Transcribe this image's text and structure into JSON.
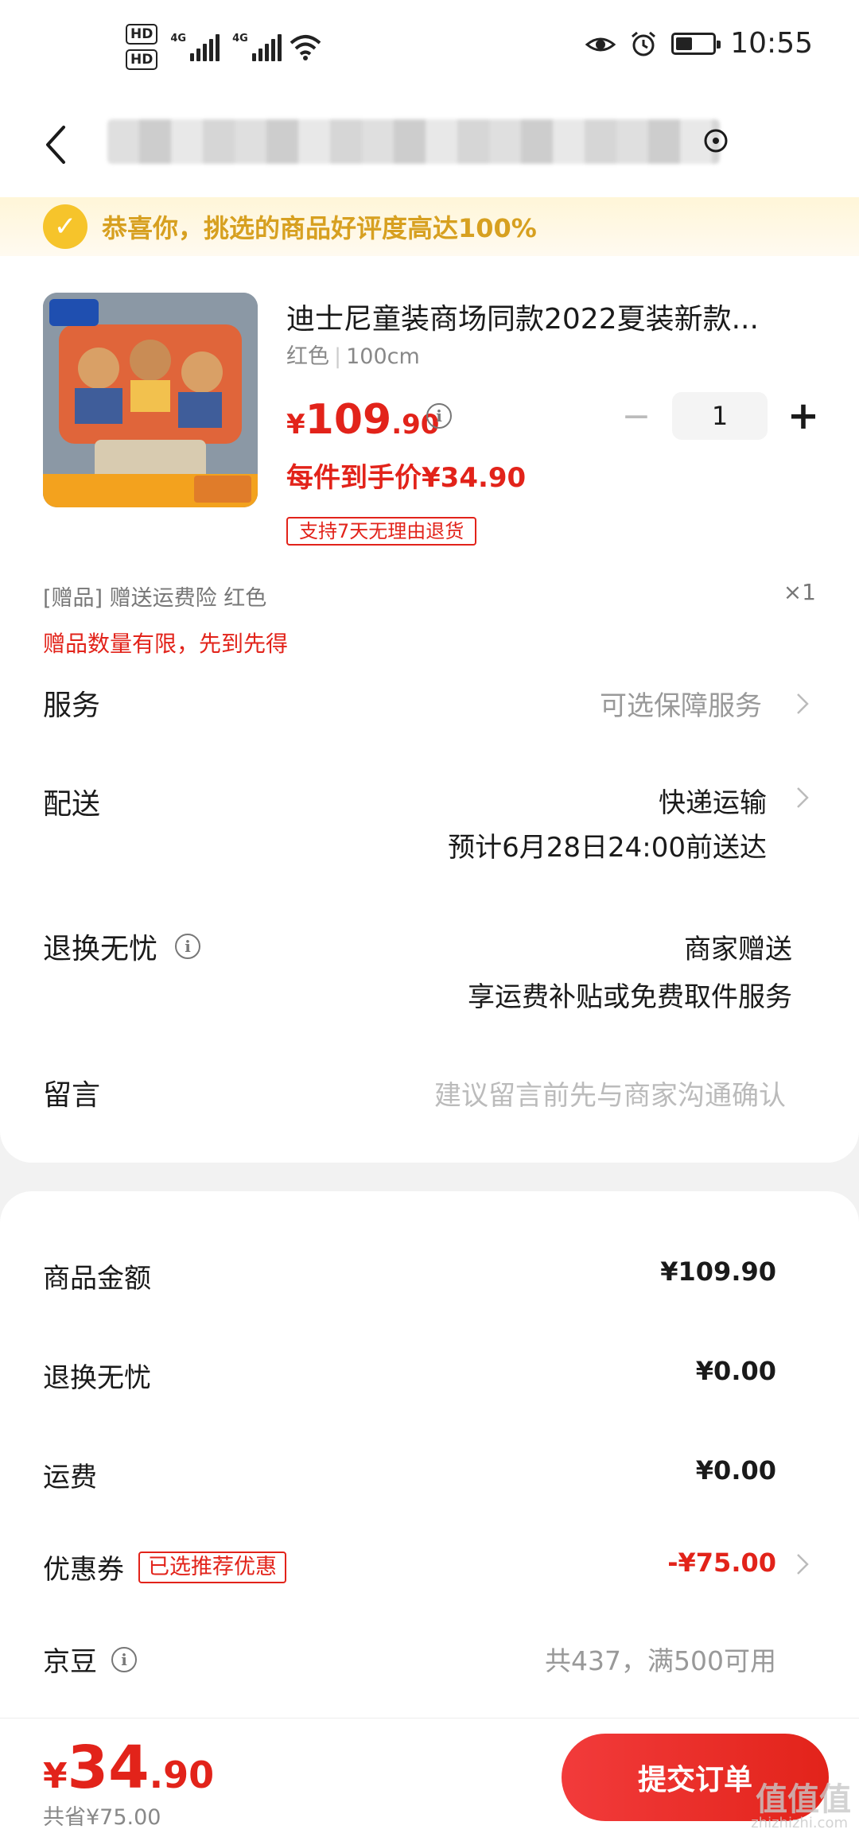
{
  "status_bar": {
    "hd1": "HD",
    "hd2": "HD",
    "net1": "4G",
    "net2": "4G",
    "time": "10:55"
  },
  "banner": {
    "text": "恭喜你，挑选的商品好评度高达100%"
  },
  "product": {
    "title": "迪士尼童装商场同款2022夏装新款...",
    "color": "红色",
    "size": "100cm",
    "price_currency": "¥",
    "price_int": "109",
    "price_dec": ".90",
    "quantity": "1",
    "hand_price": "每件到手价¥34.90",
    "return_tag": "支持7天无理由退货"
  },
  "gift": {
    "line": "[赠品]  赠送运费险 红色",
    "qty": "×1",
    "note": "赠品数量有限，先到先得"
  },
  "rows": {
    "service_label": "服务",
    "service_value": "可选保障服务",
    "delivery_label": "配送",
    "delivery_value": "快递运输",
    "delivery_eta": "预计6月28日24:00前送达",
    "worry_label": "退换无忧",
    "worry_value1": "商家赠送",
    "worry_value2": "享运费补贴或免费取件服务",
    "message_label": "留言",
    "message_placeholder": "建议留言前先与商家沟通确认"
  },
  "summary": {
    "goods_label": "商品金额",
    "goods_value": "¥109.90",
    "worry_label": "退换无忧",
    "worry_value": "¥0.00",
    "shipping_label": "运费",
    "shipping_value": "¥0.00",
    "coupon_label": "优惠券",
    "coupon_tag": "已选推荐优惠",
    "coupon_value": "-¥75.00",
    "beans_label": "京豆",
    "beans_value": "共437，满500可用"
  },
  "bottom": {
    "total_currency": "¥",
    "total_int": "34",
    "total_dec": ".90",
    "saved": "共省¥75.00",
    "submit": "提交订单",
    "watermark": "值值值",
    "watermark_sub": "zhizhizhi.com"
  },
  "colors": {
    "accent_red": "#e2231a",
    "banner_gold": "#d7a020"
  }
}
